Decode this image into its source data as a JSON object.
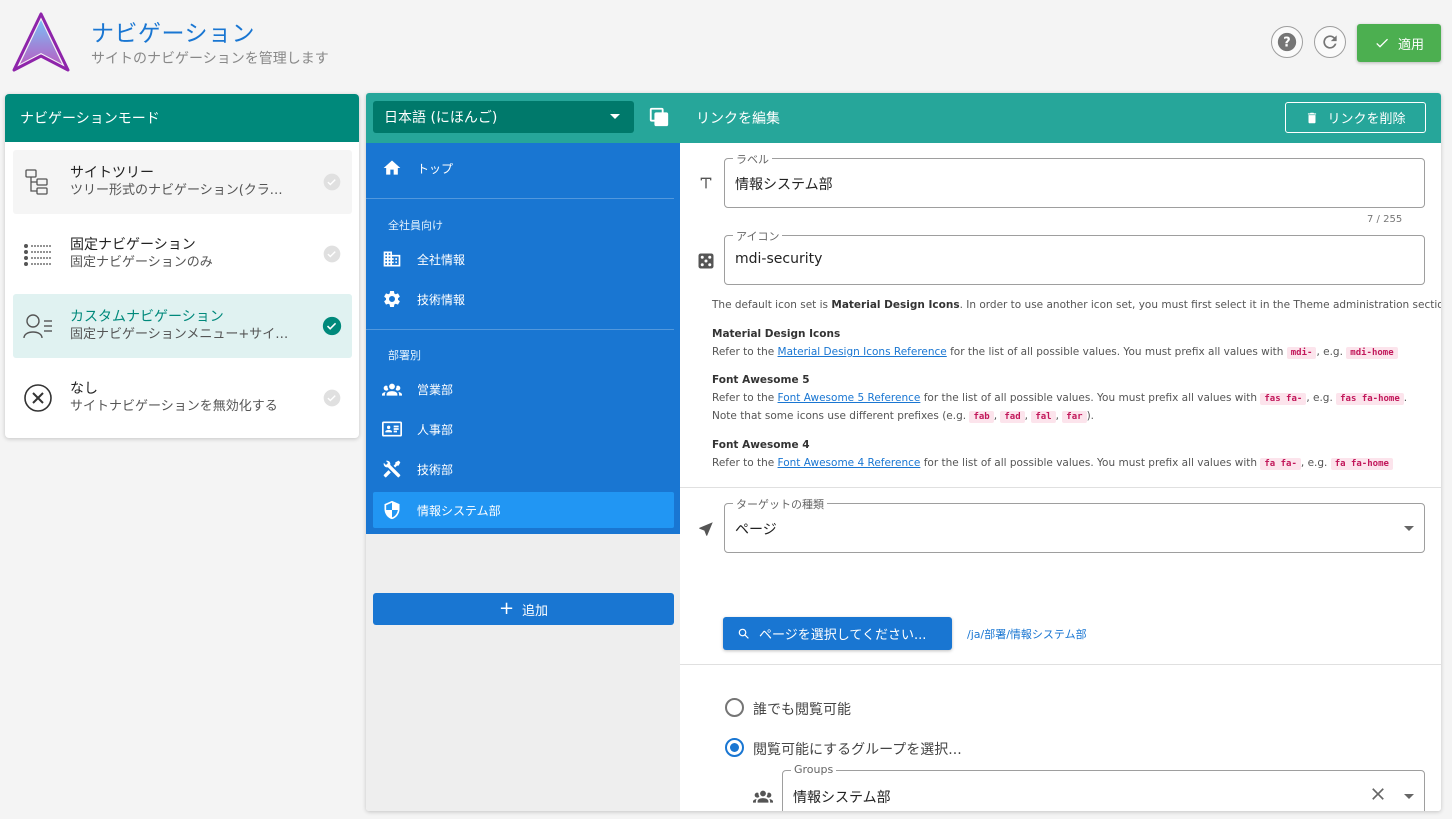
{
  "header": {
    "title": "ナビゲーション",
    "subtitle": "サイトのナビゲーションを管理します",
    "apply_label": "適用"
  },
  "mode_panel": {
    "title": "ナビゲーションモード",
    "items": [
      {
        "title": "サイトツリー",
        "desc": "ツリー形式のナビゲーション(クラシ...",
        "icon": "site-tree-icon",
        "selected": false
      },
      {
        "title": "固定ナビゲーション",
        "desc": "固定ナビゲーションのみ",
        "icon": "static-list-icon",
        "selected": false
      },
      {
        "title": "カスタムナビゲーション",
        "desc": "固定ナビゲーションメニュー+サイト...",
        "icon": "custom-user-icon",
        "selected": true
      },
      {
        "title": "なし",
        "desc": "サイトナビゲーションを無効化する",
        "icon": "disabled-icon",
        "selected": false
      }
    ]
  },
  "toolbar": {
    "locale": "日本語 (にほんご)",
    "edit_title": "リンクを編集",
    "delete_label": "リンクを削除"
  },
  "nav": {
    "top": "トップ",
    "header_all": "全社員向け",
    "company_info": "全社情報",
    "tech_info": "技術情報",
    "header_dept": "部署別",
    "sales": "営業部",
    "hr": "人事部",
    "engineering": "技術部",
    "infosys": "情報システム部",
    "add_label": "追加"
  },
  "editor": {
    "label_field": {
      "label": "ラベル",
      "value": "情報システム部",
      "counter": "7 / 255"
    },
    "icon_field": {
      "label": "アイコン",
      "value": "mdi-security"
    },
    "help": {
      "default_pre": "The default icon set is ",
      "default_bold": "Material Design Icons",
      "default_post": ". In order to use another icon set, you must first select it in the Theme administration section.",
      "mdi_title": "Material Design Icons",
      "refer_to": "Refer to the ",
      "mdi_link": "Material Design Icons Reference",
      "list_text": " for the list of all possible values. You must prefix all values with ",
      "eg": ", e.g. ",
      "mdi_prefix": "mdi-",
      "mdi_example": "mdi-home",
      "fa5_title": "Font Awesome 5",
      "fa5_link": "Font Awesome 5 Reference",
      "fa5_prefix": "fas fa-",
      "fa5_example": "fas fa-home",
      "fa5_note_pre": "Note that some icons use different prefixes (e.g. ",
      "fa5_p1": "fab",
      "fa5_p2": "fad",
      "fa5_p3": "fal",
      "fa5_p4": "far",
      "fa5_note_post": ").",
      "fa4_title": "Font Awesome 4",
      "fa4_link": "Font Awesome 4 Reference",
      "fa4_prefix": "fa fa-",
      "fa4_example": "fa fa-home"
    },
    "target_field": {
      "label": "ターゲットの種類",
      "value": "ページ"
    },
    "page_select_label": "ページを選択してください...",
    "page_path": "/ja/部署/情報システム部",
    "visibility": {
      "option_all": "誰でも閲覧可能",
      "option_groups": "閲覧可能にするグループを選択...",
      "selected": "groups"
    },
    "groups_field": {
      "label": "Groups",
      "value": "情報システム部"
    }
  },
  "colors": {
    "teal_header": "#00897b",
    "toolbar": "#26a69a",
    "nav_blue": "#1976d2",
    "nav_active": "#2196f3",
    "apply_green": "#4caf50"
  }
}
